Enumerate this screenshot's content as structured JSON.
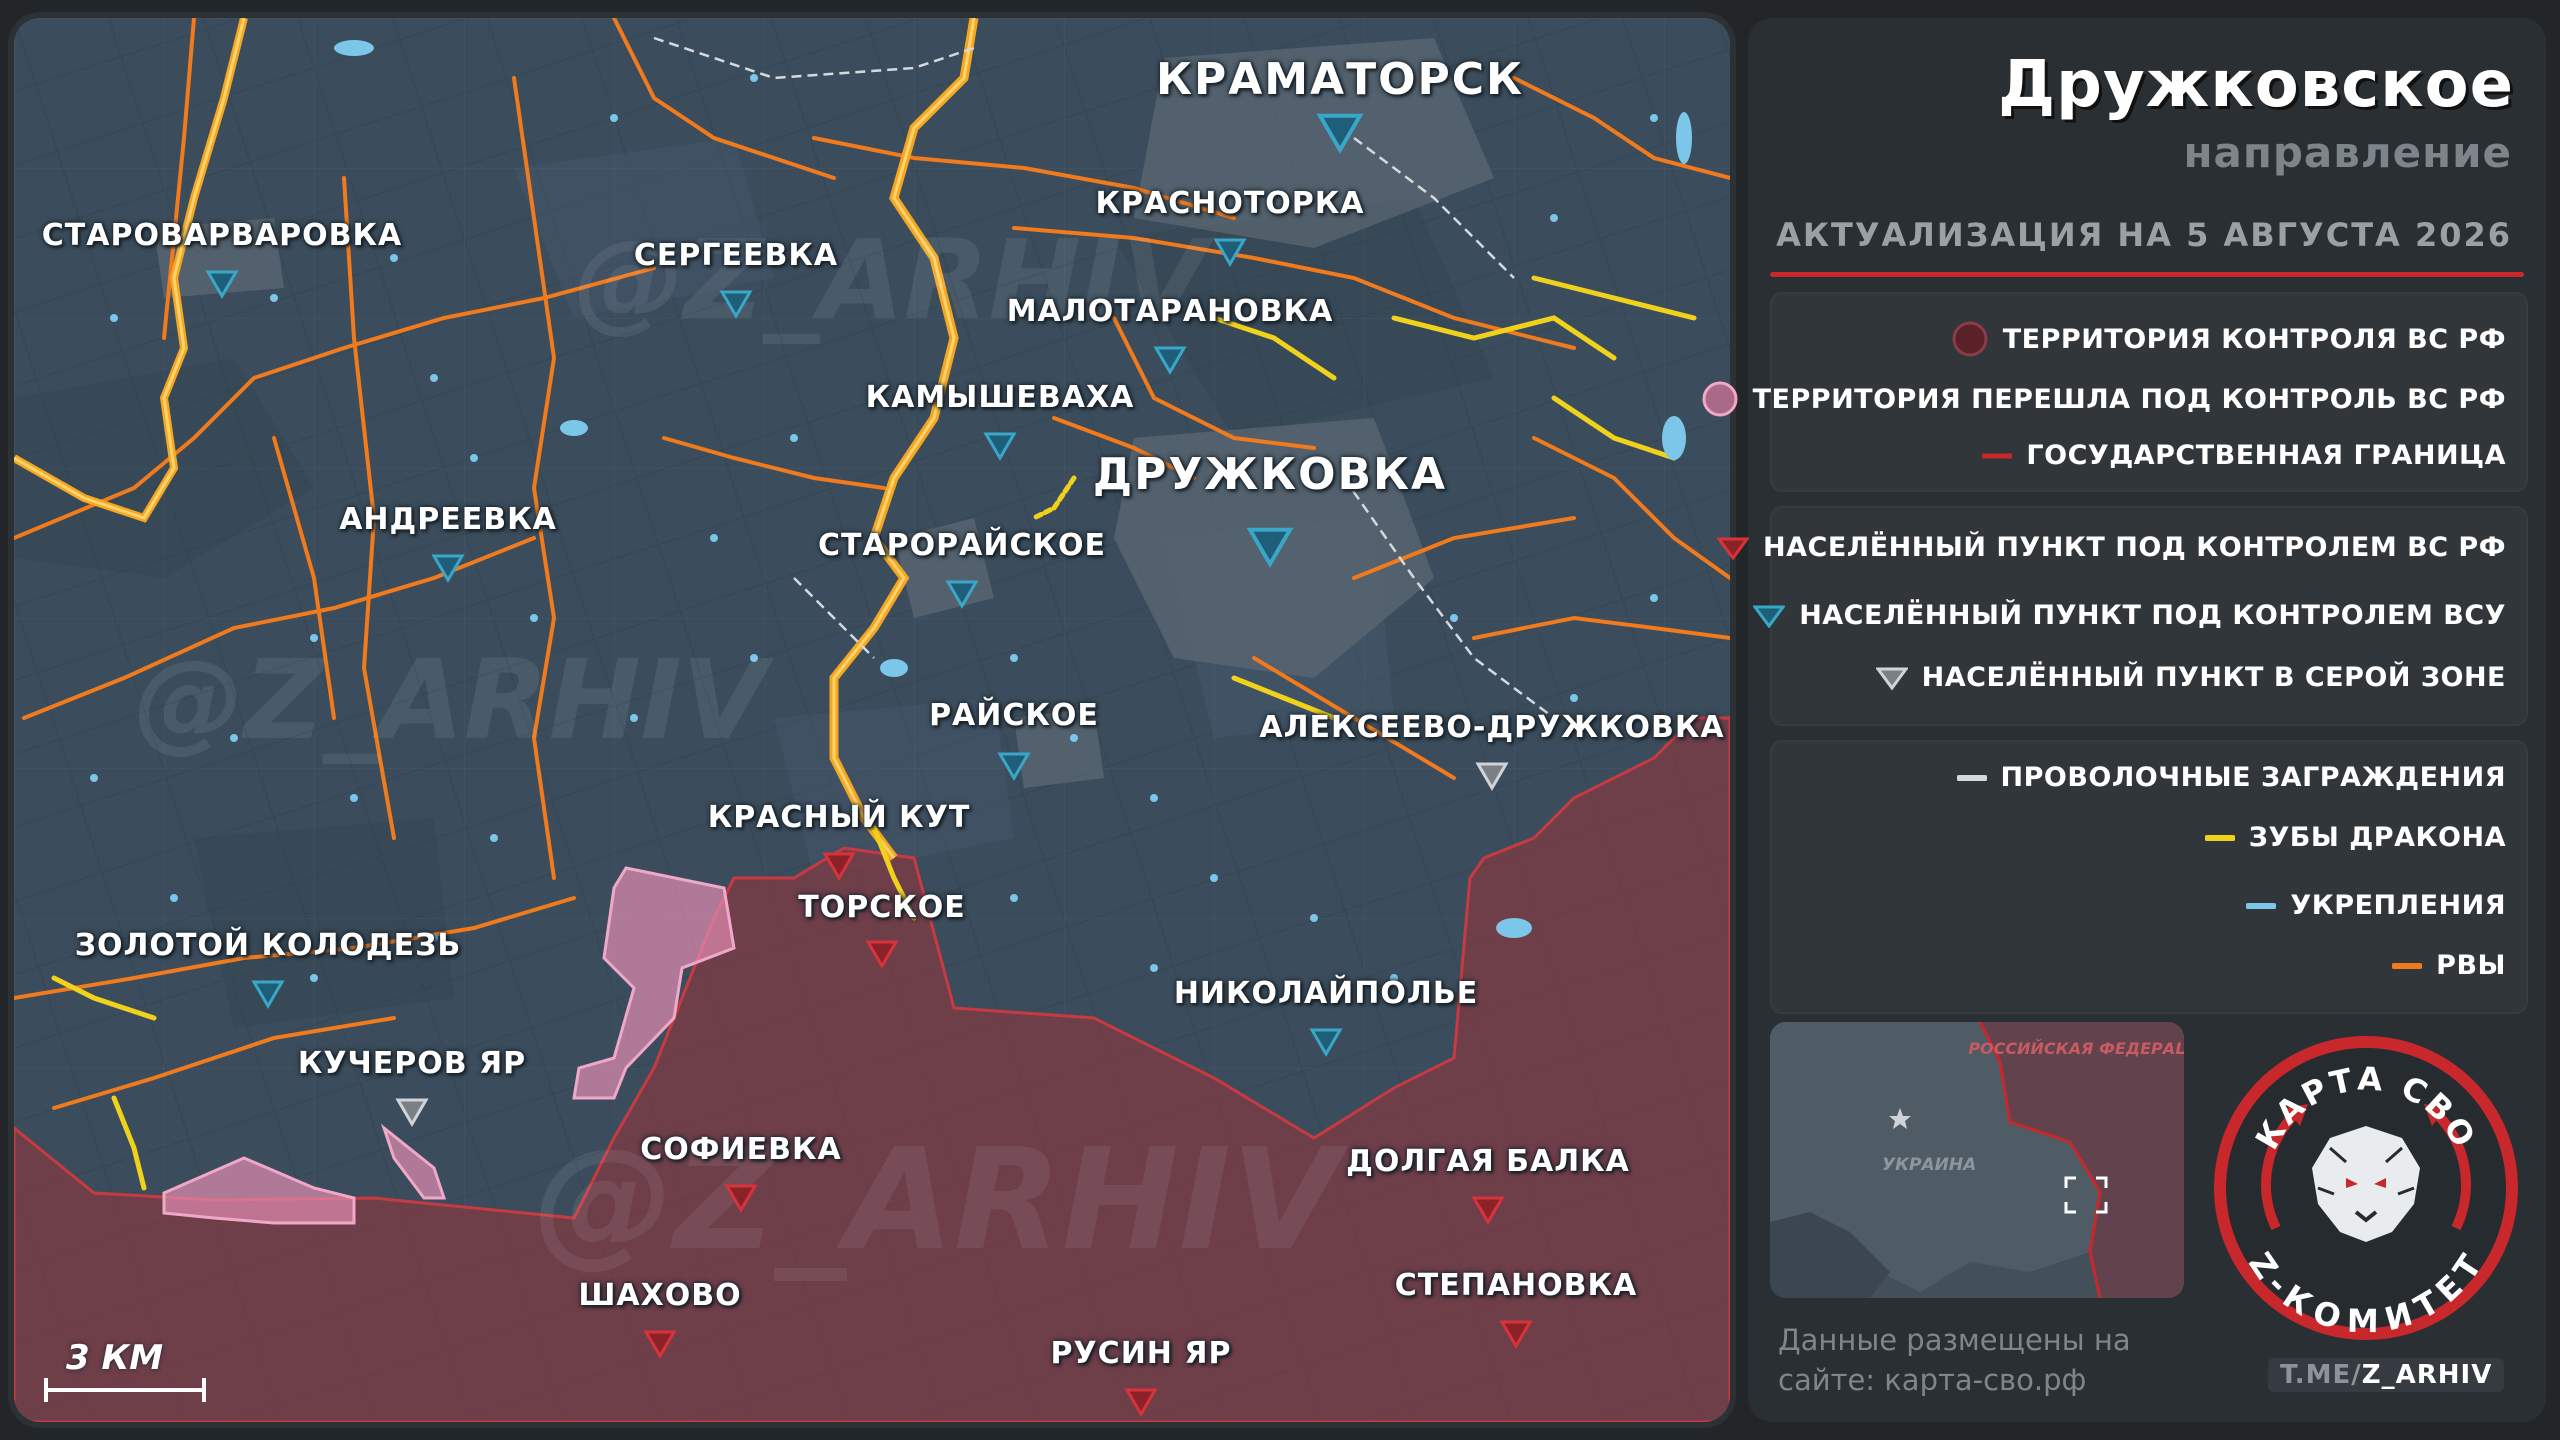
{
  "title": "Дружковское",
  "subtitle": "направление",
  "date": "АКТУАЛИЗАЦИЯ НА 5 АВГУСТА 2026",
  "legend_territory": [
    {
      "label": "ТЕРРИТОРИЯ КОНТРОЛЯ ВС РФ",
      "icon": "dark-red-circle-icon"
    },
    {
      "label": "ТЕРРИТОРИЯ ПЕРЕШЛА ПОД КОНТРОЛЬ ВС РФ",
      "icon": "pink-circle-icon"
    },
    {
      "label": "ГОСУДАРСТВЕННАЯ ГРАНИЦА",
      "icon": "border-line-icon"
    }
  ],
  "legend_settlements": [
    {
      "label": "НАСЕЛЁННЫЙ ПУНКТ ПОД КОНТРОЛЕМ ВС РФ",
      "icon": "red-triangle-icon"
    },
    {
      "label": "НАСЕЛЁННЫЙ ПУНКТ ПОД КОНТРОЛЕМ ВСУ",
      "icon": "blue-triangle-icon"
    },
    {
      "label": "НАСЕЛЁННЫЙ ПУНКТ В СЕРОЙ ЗОНЕ",
      "icon": "grey-triangle-icon"
    }
  ],
  "legend_fortifications": [
    {
      "label": "ПРОВОЛОЧНЫЕ ЗАГРАЖДЕНИЯ",
      "icon": "wire-line-icon"
    },
    {
      "label": "ЗУБЫ ДРАКОНА",
      "icon": "dragon-teeth-line-icon"
    },
    {
      "label": "УКРЕПЛЕНИЯ",
      "icon": "fortification-line-icon"
    },
    {
      "label": "РВЫ",
      "icon": "ditch-line-icon"
    }
  ],
  "colors": {
    "ru_control": "#8a3c48",
    "ru_new": "#e28db0",
    "ua_marker": "#3aa6c8",
    "ru_marker": "#d8333a",
    "grey_marker": "#d0d4d8",
    "ditch": "#f07a1c",
    "dragon_teeth": "#f0d21c",
    "fortification": "#7cc6ea",
    "wire": "#d6d9dc",
    "accent": "#c8282c"
  },
  "inset": {
    "russia_label": "РОССИЙСКАЯ ФЕДЕРАЦИЯ",
    "ukraine_label": "УКРАИНА"
  },
  "scale": {
    "label": "3 КМ"
  },
  "watermark": "@Z_ARHIV",
  "source_note": "Данные размещены на сайте: карта-сво.рф",
  "logo": {
    "top_text": "КАРТА СВО",
    "bottom_text": "Z-КОМИТЕТ"
  },
  "telegram": {
    "prefix": "T.ME/",
    "handle": "Z_ARHIV"
  },
  "settlements": [
    {
      "name": "КРАМАТОРСК",
      "status": "ua",
      "big": true
    },
    {
      "name": "КРАСНОТОРКА",
      "status": "ua"
    },
    {
      "name": "СТАРОВАРВАРОВКА",
      "status": "ua"
    },
    {
      "name": "СЕРГЕЕВКА",
      "status": "ua"
    },
    {
      "name": "МАЛОТАРАНОВКА",
      "status": "ua"
    },
    {
      "name": "КАМЫШЕВАХА",
      "status": "ua"
    },
    {
      "name": "ДРУЖКОВКА",
      "status": "ua",
      "big": true
    },
    {
      "name": "АНДРЕЕВКА",
      "status": "ua"
    },
    {
      "name": "СТАРОРАЙСКОЕ",
      "status": "ua"
    },
    {
      "name": "РАЙСКОЕ",
      "status": "ua"
    },
    {
      "name": "АЛЕКСЕЕВО-ДРУЖКОВКА",
      "status": "grey"
    },
    {
      "name": "КРАСНЫЙ КУТ",
      "status": "ru"
    },
    {
      "name": "ТОРСКОЕ",
      "status": "ru"
    },
    {
      "name": "ЗОЛОТОЙ КОЛОДЕЗЬ",
      "status": "ua"
    },
    {
      "name": "НИКОЛАЙПОЛЬЕ",
      "status": "ua"
    },
    {
      "name": "КУЧЕРОВ ЯР",
      "status": "grey"
    },
    {
      "name": "СОФИЕВКА",
      "status": "ru"
    },
    {
      "name": "ДОЛГАЯ БАЛКА",
      "status": "ru"
    },
    {
      "name": "ШАХОВО",
      "status": "ru"
    },
    {
      "name": "СТЕПАНОВКА",
      "status": "ru"
    },
    {
      "name": "РУСИН ЯР",
      "status": "ru"
    }
  ]
}
